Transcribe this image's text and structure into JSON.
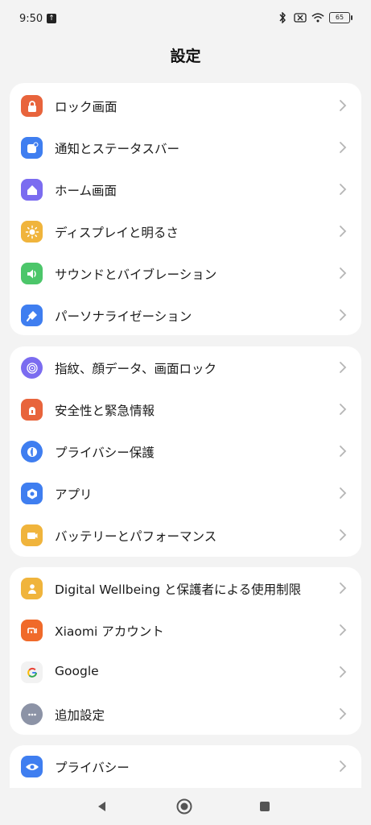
{
  "status": {
    "time": "9:50",
    "battery": "65",
    "notif_icon": "upload-icon"
  },
  "title": "設定",
  "groups": [
    {
      "items": [
        {
          "label": "ロック画面",
          "icon": "lock-icon",
          "color": "#e8643c"
        },
        {
          "label": "通知とステータスバー",
          "icon": "notification-icon",
          "color": "#3f7ef0"
        },
        {
          "label": "ホーム画面",
          "icon": "home-icon",
          "color": "#7b6cf0"
        },
        {
          "label": "ディスプレイと明るさ",
          "icon": "sun-icon",
          "color": "#f0b43c"
        },
        {
          "label": "サウンドとバイブレーション",
          "icon": "speaker-icon",
          "color": "#4cc66a"
        },
        {
          "label": "パーソナライゼーション",
          "icon": "brush-icon",
          "color": "#3f7ef0"
        }
      ]
    },
    {
      "items": [
        {
          "label": "指紋、顔データ、画面ロック",
          "icon": "fingerprint-icon",
          "color": "#7b6cf0"
        },
        {
          "label": "安全性と緊急情報",
          "icon": "emergency-icon",
          "color": "#e8643c"
        },
        {
          "label": "プライバシー保護",
          "icon": "shield-icon",
          "color": "#3f7ef0"
        },
        {
          "label": "アプリ",
          "icon": "apps-icon",
          "color": "#3f7ef0"
        },
        {
          "label": "バッテリーとパフォーマンス",
          "icon": "battery-icon",
          "color": "#f0b43c"
        }
      ]
    },
    {
      "items": [
        {
          "label": "Digital Wellbeing と保護者による使用制限",
          "icon": "wellbeing-icon",
          "color": "#f0b43c"
        },
        {
          "label": "Xiaomi アカウント",
          "icon": "xiaomi-icon",
          "color": "#f06a2a"
        },
        {
          "label": "Google",
          "icon": "google-icon",
          "color": "#f2f2f2"
        },
        {
          "label": "追加設定",
          "icon": "more-icon",
          "color": "#8c93a6"
        }
      ]
    },
    {
      "items": [
        {
          "label": "プライバシー",
          "icon": "eye-icon",
          "color": "#3f7ef0"
        }
      ]
    }
  ],
  "nav": {
    "back_icon": "back-icon",
    "home_icon": "home-circle-icon",
    "recents_icon": "recents-icon"
  }
}
